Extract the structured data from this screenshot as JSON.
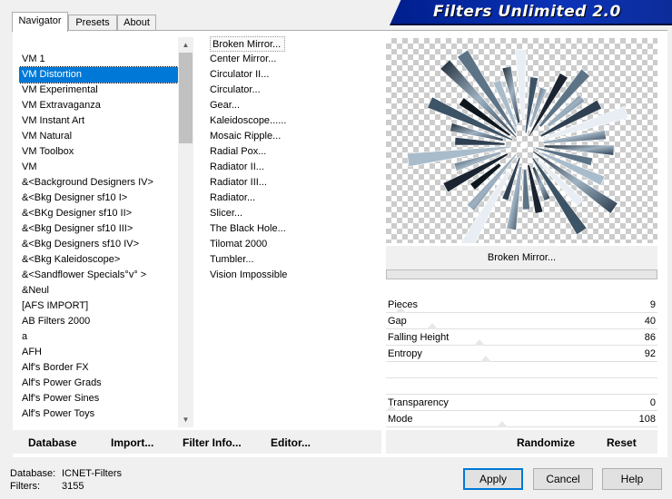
{
  "tabs": [
    "Navigator",
    "Presets",
    "About"
  ],
  "banner_title": "Filters Unlimited 2.0",
  "categories": [
    "VM 1",
    "VM Distortion",
    "VM Experimental",
    "VM Extravaganza",
    "VM Instant Art",
    "VM Natural",
    "VM Toolbox",
    "VM",
    "&<Background Designers IV>",
    "&<Bkg Designer sf10 I>",
    "&<BKg Designer sf10 II>",
    "&<Bkg Designer sf10 III>",
    "&<Bkg Designers sf10 IV>",
    "&<Bkg Kaleidoscope>",
    "&<Sandflower Specials°v° >",
    "&Neul",
    "[AFS IMPORT]",
    "AB Filters 2000",
    "a",
    "AFH",
    "Alf's Border FX",
    "Alf's Power Grads",
    "Alf's Power Sines",
    "Alf's Power Toys"
  ],
  "selected_category": "VM Distortion",
  "filters": [
    "Broken Mirror...",
    "Center Mirror...",
    "Circulator II...",
    "Circulator...",
    "Gear...",
    "Kaleidoscope......",
    "Mosaic Ripple...",
    "Radial Pox...",
    "Radiator II...",
    "Radiator III...",
    "Radiator...",
    "Slicer...",
    "The Black Hole...",
    "Tilomat 2000",
    "Tumbler...",
    "Vision Impossible"
  ],
  "current_filter": "Broken Mirror...",
  "params": [
    {
      "label": "Pieces",
      "value": "9",
      "level": 9
    },
    {
      "label": "Gap",
      "value": "40",
      "level": 40
    },
    {
      "label": "Falling Height",
      "value": "86",
      "level": 86
    },
    {
      "label": "Entropy",
      "value": "92",
      "level": 92
    },
    {
      "label": "",
      "value": "",
      "level": null
    },
    {
      "label": "",
      "value": "",
      "level": null
    },
    {
      "label": "Transparency",
      "value": "0",
      "level": 0
    },
    {
      "label": "Mode",
      "value": "108",
      "level": 108
    }
  ],
  "toolbar": {
    "database": "Database",
    "import": "Import...",
    "filter_info": "Filter Info...",
    "editor": "Editor...",
    "randomize": "Randomize",
    "reset": "Reset"
  },
  "footer": {
    "database_label": "Database:",
    "database_value": "ICNET-Filters",
    "filters_label": "Filters:",
    "filters_value": "3155"
  },
  "buttons": {
    "apply": "Apply",
    "cancel": "Cancel",
    "help": "Help"
  },
  "colors": {
    "selection": "#0078d7",
    "banner": "#0b33b8",
    "default_button_border": "#0078d7"
  }
}
